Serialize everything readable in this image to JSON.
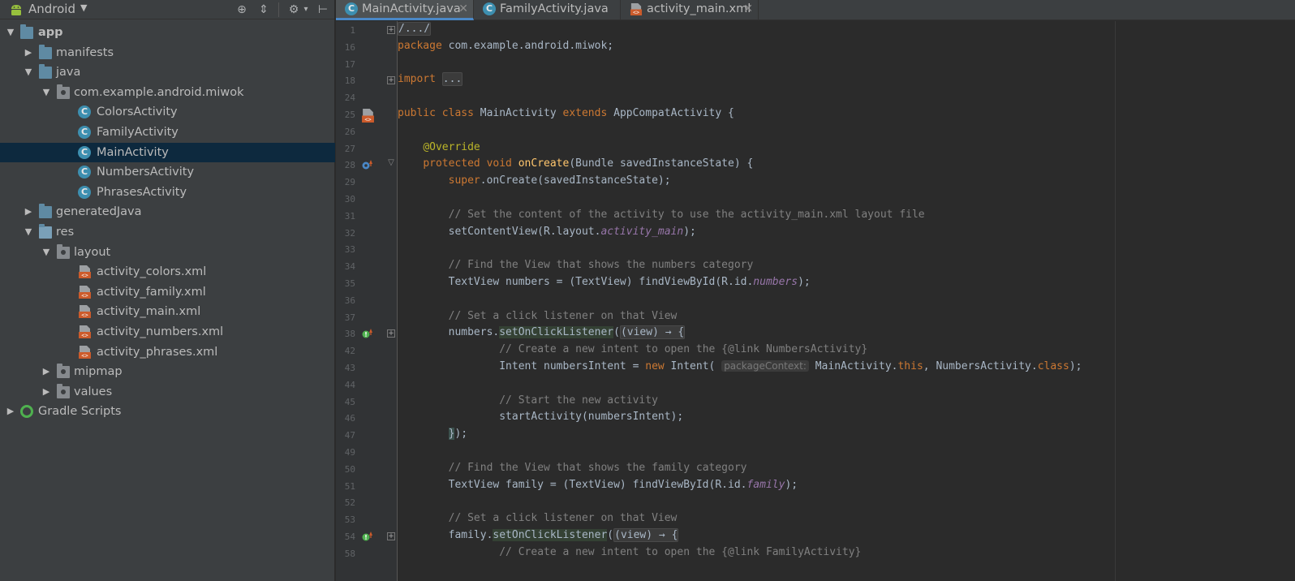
{
  "project_panel": {
    "view_selector": "Android",
    "tree": [
      {
        "label": "app",
        "level": 0,
        "expanded": true,
        "type": "module",
        "bold": true
      },
      {
        "label": "manifests",
        "level": 1,
        "expanded": false,
        "type": "folder"
      },
      {
        "label": "java",
        "level": 1,
        "expanded": true,
        "type": "folder"
      },
      {
        "label": "com.example.android.miwok",
        "level": 2,
        "expanded": true,
        "type": "package"
      },
      {
        "label": "ColorsActivity",
        "level": 3,
        "type": "class"
      },
      {
        "label": "FamilyActivity",
        "level": 3,
        "type": "class"
      },
      {
        "label": "MainActivity",
        "level": 3,
        "type": "class",
        "selected": true
      },
      {
        "label": "NumbersActivity",
        "level": 3,
        "type": "class"
      },
      {
        "label": "PhrasesActivity",
        "level": 3,
        "type": "class"
      },
      {
        "label": "generatedJava",
        "level": 1,
        "expanded": false,
        "type": "folder-gen"
      },
      {
        "label": "res",
        "level": 1,
        "expanded": true,
        "type": "folder-res"
      },
      {
        "label": "layout",
        "level": 2,
        "expanded": true,
        "type": "package"
      },
      {
        "label": "activity_colors.xml",
        "level": 3,
        "type": "xml"
      },
      {
        "label": "activity_family.xml",
        "level": 3,
        "type": "xml"
      },
      {
        "label": "activity_main.xml",
        "level": 3,
        "type": "xml"
      },
      {
        "label": "activity_numbers.xml",
        "level": 3,
        "type": "xml"
      },
      {
        "label": "activity_phrases.xml",
        "level": 3,
        "type": "xml"
      },
      {
        "label": "mipmap",
        "level": 2,
        "expanded": false,
        "type": "package"
      },
      {
        "label": "values",
        "level": 2,
        "expanded": false,
        "type": "package"
      },
      {
        "label": "Gradle Scripts",
        "level": 0,
        "expanded": false,
        "type": "gradle"
      }
    ]
  },
  "tabs": [
    {
      "label": "MainActivity.java",
      "icon": "class-icon",
      "active": true
    },
    {
      "label": "FamilyActivity.java",
      "icon": "class-icon",
      "active": false
    },
    {
      "label": "activity_main.xml",
      "icon": "xml-icon",
      "active": false
    }
  ],
  "editor": {
    "lines": [
      {
        "n": "1",
        "fold": "box",
        "html": "<span class=\"fold-box\">/.../</span>"
      },
      {
        "n": "16",
        "html": "<span class=\"kw\">package</span> com.example.android.miwok;"
      },
      {
        "n": "17",
        "html": ""
      },
      {
        "n": "18",
        "fold": "box",
        "html": "<span class=\"kw\">import</span> <span class=\"fold-box\">...</span>"
      },
      {
        "n": "24",
        "html": ""
      },
      {
        "n": "25",
        "mark": "layout",
        "html": "<span class=\"kw\">public class</span> MainActivity <span class=\"kw\">extends</span> AppCompatActivity {"
      },
      {
        "n": "26",
        "html": ""
      },
      {
        "n": "27",
        "html": "    <span class=\"ann\">@Override</span>"
      },
      {
        "n": "28",
        "mark": "override",
        "fold": "end",
        "html": "    <span class=\"kw\">protected void</span> <span class=\"fn\">onCreate</span>(Bundle savedInstanceState) {"
      },
      {
        "n": "29",
        "html": "        <span class=\"kw\">super</span>.onCreate(savedInstanceState);"
      },
      {
        "n": "30",
        "html": ""
      },
      {
        "n": "31",
        "html": "        <span class=\"cm\">// Set the content of the activity to use the activity_main.xml layout file</span>"
      },
      {
        "n": "32",
        "html": "        setContentView(R.layout.<span class=\"fld\">activity_main</span>);"
      },
      {
        "n": "33",
        "html": ""
      },
      {
        "n": "34",
        "html": "        <span class=\"cm\">// Find the View that shows the numbers category</span>"
      },
      {
        "n": "35",
        "html": "        TextView numbers = (TextView) findViewById(R.id.<span class=\"fld\">numbers</span>);"
      },
      {
        "n": "36",
        "html": ""
      },
      {
        "n": "37",
        "html": "        <span class=\"cm\">// Set a click listener on that View</span>"
      },
      {
        "n": "38",
        "mark": "impl",
        "fold": "box",
        "html": "        numbers.<span class=\"hl\">setOnClickListener</span>(<span class=\"fold-box\">(view) → {</span>"
      },
      {
        "n": "42",
        "html": "                <span class=\"cm\">// Create a new intent to open the {@link NumbersActivity}</span>"
      },
      {
        "n": "43",
        "html": "                Intent numbersIntent = <span class=\"kw\">new</span> Intent( <span class=\"hint\">packageContext:</span> MainActivity.<span class=\"kw\">this</span>, NumbersActivity.<span class=\"kw\">class</span>);"
      },
      {
        "n": "44",
        "html": ""
      },
      {
        "n": "45",
        "html": "                <span class=\"cm\">// Start the new activity</span>"
      },
      {
        "n": "46",
        "html": "                startActivity(numbersIntent);"
      },
      {
        "n": "47",
        "html": "        <span class=\"brace-hl\">}</span>);"
      },
      {
        "n": "49",
        "html": ""
      },
      {
        "n": "50",
        "html": "        <span class=\"cm\">// Find the View that shows the family category</span>"
      },
      {
        "n": "51",
        "html": "        TextView family = (TextView) findViewById(R.id.<span class=\"fld\">family</span>);"
      },
      {
        "n": "52",
        "html": ""
      },
      {
        "n": "53",
        "html": "        <span class=\"cm\">// Set a click listener on that View</span>"
      },
      {
        "n": "54",
        "mark": "impl",
        "fold": "box",
        "html": "        family.<span class=\"hl\">setOnClickListener</span>(<span class=\"fold-box\">(view) → {</span>"
      },
      {
        "n": "58",
        "html": "                <span class=\"cm\">// Create a new intent to open the {@link FamilyActivity}</span>"
      }
    ]
  }
}
